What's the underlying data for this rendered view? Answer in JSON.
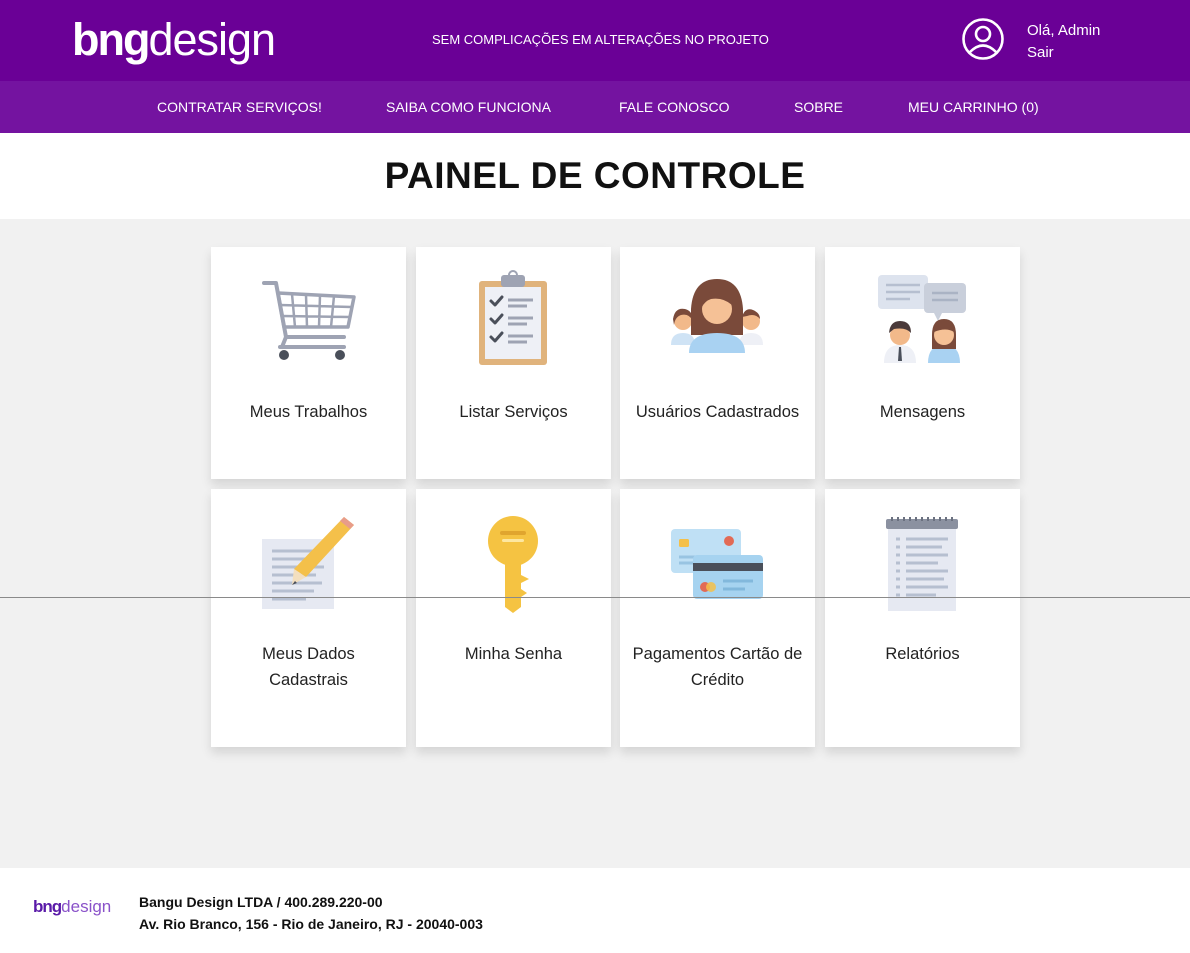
{
  "header": {
    "logo_bold": "bng",
    "logo_light": "design",
    "tagline": "SEM COMPLICAÇÕES EM ALTERAÇÕES NO PROJETO",
    "greeting": "Olá, Admin",
    "logout": "Sair",
    "user_icon": "user-circle-icon"
  },
  "nav": {
    "items": [
      {
        "label": "CONTRATAR SERVIÇOS!"
      },
      {
        "label": "SAIBA COMO FUNCIONA"
      },
      {
        "label": "FALE CONOSCO"
      },
      {
        "label": "SOBRE"
      },
      {
        "label": "MEU CARRINHO (0)"
      }
    ]
  },
  "page": {
    "title": "PAINEL DE CONTROLE"
  },
  "cards": [
    {
      "label": "Meus Trabalhos",
      "icon": "shopping-cart-icon"
    },
    {
      "label": "Listar Serviços",
      "icon": "clipboard-checklist-icon"
    },
    {
      "label": "Usuários Cadastrados",
      "icon": "users-group-icon"
    },
    {
      "label": "Mensagens",
      "icon": "chat-messages-icon"
    },
    {
      "label": "Meus Dados Cadastrais",
      "icon": "document-pencil-icon"
    },
    {
      "label": "Minha Senha",
      "icon": "key-icon"
    },
    {
      "label": "Pagamentos Cartão de Crédito",
      "icon": "credit-cards-icon"
    },
    {
      "label": "Relatórios",
      "icon": "notepad-report-icon"
    }
  ],
  "footer": {
    "logo_bold": "bng",
    "logo_light": "design",
    "company": "Bangu Design LTDA / 400.289.220-00",
    "address": "Av. Rio Branco, 156 - Rio de Janeiro, RJ - 20040-003"
  },
  "colors": {
    "header_bg": "#6a0096",
    "nav_bg": "#7413a0",
    "page_bg": "#f1f1f1"
  }
}
